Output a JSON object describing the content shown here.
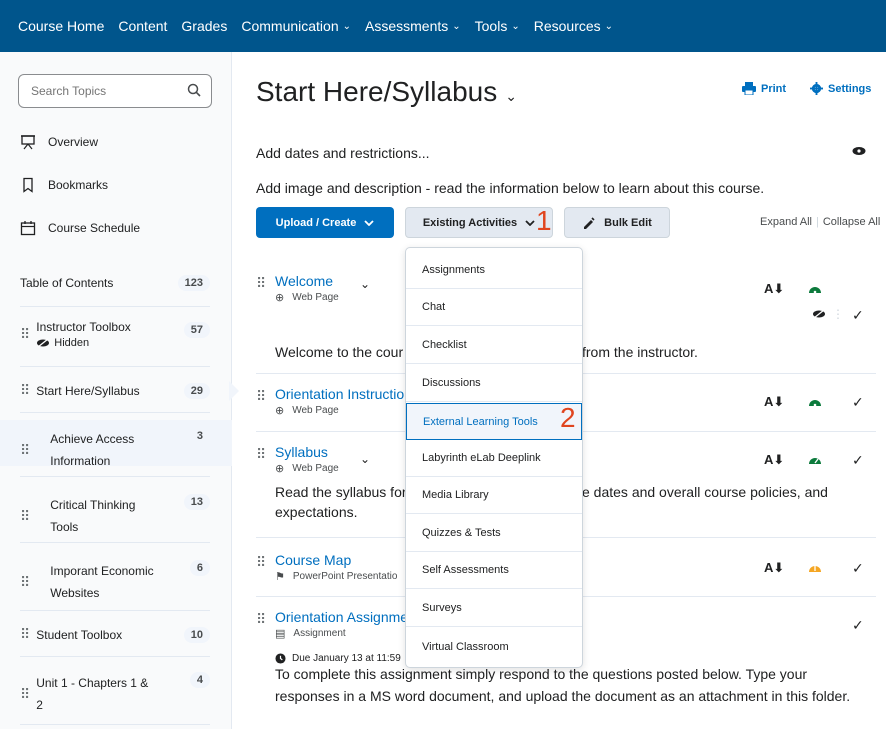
{
  "topnav": {
    "items": [
      {
        "label": "Course Home",
        "has_caret": false
      },
      {
        "label": "Content",
        "has_caret": false
      },
      {
        "label": "Grades",
        "has_caret": false
      },
      {
        "label": "Communication",
        "has_caret": true
      },
      {
        "label": "Assessments",
        "has_caret": true
      },
      {
        "label": "Tools",
        "has_caret": true
      },
      {
        "label": "Resources",
        "has_caret": true
      }
    ],
    "caret_glyph": "⌄",
    "bg_color": "#00558c"
  },
  "sidebar": {
    "search_placeholder": "Search Topics",
    "links": {
      "overview": "Overview",
      "bookmarks": "Bookmarks",
      "schedule": "Course Schedule"
    },
    "toc": {
      "label": "Table of Contents",
      "count": "123"
    },
    "modules": [
      {
        "label": "Instructor Toolbox",
        "count": "57",
        "sub": "Hidden"
      },
      {
        "label": "Start Here/Syllabus",
        "count": "29"
      },
      {
        "label": "Achieve Access",
        "label2": "Information",
        "count": "3"
      },
      {
        "label": "Critical Thinking",
        "label2": "Tools",
        "count": "13"
      },
      {
        "label": "Imporant Economic",
        "label2": "Websites",
        "count": "6"
      },
      {
        "label": "Student Toolbox",
        "count": "10"
      },
      {
        "label": "Unit 1 - Chapters 1 &",
        "label2": "2",
        "count": "4"
      }
    ]
  },
  "main": {
    "title": "Start Here/Syllabus",
    "title_chevron": "⌄",
    "print_label": "Print",
    "settings_label": "Settings",
    "dates_link": "Add dates and restrictions...",
    "description_line": "Add image and description -  read the information below to learn about this course.",
    "upload_label": "Upload / Create",
    "existing_label": "Existing Activities",
    "bulk_label": "Bulk Edit",
    "expand_all": "Expand All",
    "collapse_all": "Collapse All",
    "annotations": {
      "one": "1",
      "two": "2"
    }
  },
  "items": [
    {
      "title": "Welcome",
      "type": "Web Page",
      "desc": "Welcome to the cour",
      "desc2": "from the instructor."
    },
    {
      "title": "Orientation Instructio",
      "type": "Web Page"
    },
    {
      "title": "Syllabus",
      "type": "Web Page",
      "desc": "Read the syllabus for",
      "desc_b": "expectations.",
      "desc2": "e dates and overall course policies, and"
    },
    {
      "title": "Course Map",
      "type": "PowerPoint Presentatio"
    },
    {
      "title": "Orientation Assignme",
      "type": "Assignment",
      "due": "Due January 13 at 11:59"
    }
  ],
  "footer_text": {
    "line1": "To complete this assignment simply respond to the questions posted below. Type your",
    "line2": "responses in a MS word document, and upload the document as an attachment in this folder."
  },
  "dropdown": {
    "items": [
      "Assignments",
      "Chat",
      "Checklist",
      "Discussions",
      "External Learning Tools",
      "Labyrinth eLab Deeplink",
      "Media Library",
      "Quizzes & Tests",
      "Self Assessments",
      "Surveys",
      "Virtual Classroom"
    ],
    "active": "External Learning Tools"
  },
  "colors": {
    "link": "#006fbf",
    "accent_red": "#e0451f",
    "gauge_green": "#0c7a3c",
    "gauge_orange": "#f5a623"
  },
  "icons": [
    "search-icon",
    "presentation-icon",
    "bookmark-icon",
    "calendar-icon",
    "hidden-eye-icon",
    "print-icon",
    "gear-icon",
    "eye-icon",
    "chevron-down-icon",
    "globe-icon",
    "powerpoint-icon",
    "assignment-icon",
    "clock-icon",
    "checkmark-icon",
    "sort-icon",
    "gauge-icon",
    "pencil-icon"
  ]
}
